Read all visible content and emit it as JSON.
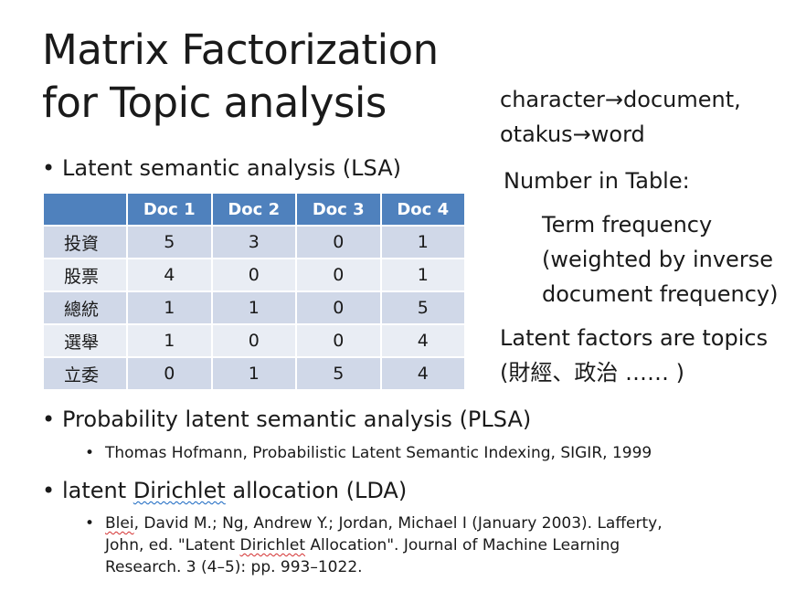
{
  "title": {
    "line1": "Matrix Factorization",
    "line2": "for Topic analysis"
  },
  "bullets": {
    "lsa": "Latent semantic analysis (LSA)",
    "plsa": "Probability latent semantic analysis (PLSA)",
    "plsa_ref": "Thomas Hofmann, Probabilistic Latent Semantic Indexing, SIGIR, 1999",
    "lda_pre": "latent ",
    "lda_word": "Dirichlet",
    "lda_post": " allocation (LDA)",
    "lda_ref": {
      "blei": "Blei",
      "part1": ", David M.; Ng, Andrew Y.; Jordan, Michael I (January 2003). Lafferty,",
      "part2_pre": "John, ed. \"Latent ",
      "dirichlet": "Dirichlet",
      "part2_post": " Allocation\". Journal of Machine Learning",
      "part3": "Research. 3 (4–5): pp. 993–1022."
    },
    "dot": "•"
  },
  "table": {
    "headers": [
      "",
      "Doc 1",
      "Doc 2",
      "Doc 3",
      "Doc 4"
    ],
    "rows": [
      {
        "term": "投資",
        "values": [
          "5",
          "3",
          "0",
          "1"
        ]
      },
      {
        "term": "股票",
        "values": [
          "4",
          "0",
          "0",
          "1"
        ]
      },
      {
        "term": "總統",
        "values": [
          "1",
          "1",
          "0",
          "5"
        ]
      },
      {
        "term": "選舉",
        "values": [
          "1",
          "0",
          "0",
          "4"
        ]
      },
      {
        "term": "立委",
        "values": [
          "0",
          "1",
          "5",
          "4"
        ]
      }
    ]
  },
  "side": {
    "mapping1": "character→document,",
    "mapping2": "otakus→word",
    "number_label": "Number in Table:",
    "tf1": "Term frequency",
    "tf2": "(weighted by inverse",
    "tf3": "document frequency)",
    "latent1": "Latent factors are topics",
    "latent2": "(財經、政治 …… )"
  }
}
